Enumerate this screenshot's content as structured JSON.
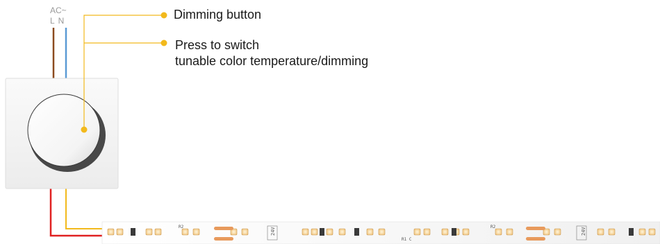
{
  "supply": {
    "ac_label": "AC~",
    "terminal_labels": "L N"
  },
  "callouts": {
    "dimming_button": "Dimming button",
    "press_line_1": "Press to switch",
    "press_line_2": "tunable color temperature/dimming"
  },
  "colors": {
    "live_wire": "#8b4a1e",
    "neutral_wire": "#5b9bd5",
    "output_red": "#e02020",
    "output_yellow": "#f2b91c",
    "leader_line": "#f2b91c"
  },
  "strip": {
    "segment_labels": [
      "24V",
      "24V"
    ],
    "resistor_labels": [
      "R2",
      "R2",
      "R1 C"
    ]
  }
}
